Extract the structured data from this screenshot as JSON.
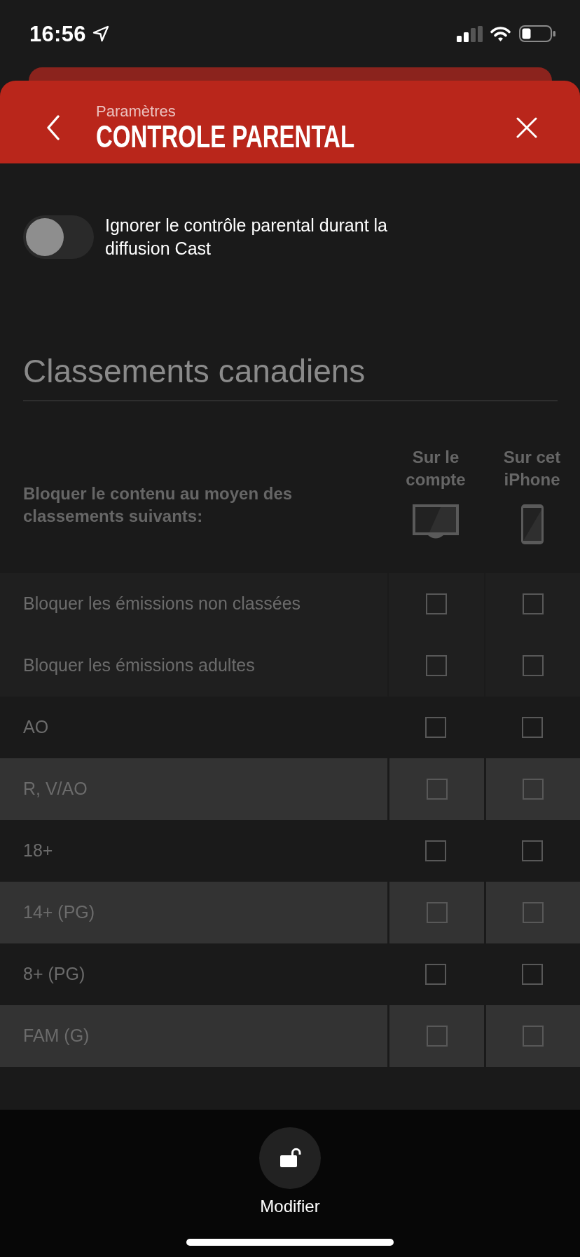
{
  "status_bar": {
    "time": "16:56"
  },
  "header": {
    "subtitle": "Paramètres",
    "title": "CONTROLE PARENTAL"
  },
  "cast_toggle": {
    "label": "Ignorer le contrôle parental durant la diffusion Cast",
    "on": false
  },
  "section": {
    "title": "Classements canadiens"
  },
  "table": {
    "heading": "Bloquer le contenu au moyen des classements suivants:",
    "columns": [
      {
        "label": "Sur le compte",
        "kind": "account"
      },
      {
        "label": "Sur cet iPhone",
        "kind": "device"
      }
    ],
    "rows": [
      {
        "kind": "filter",
        "label": "Bloquer les émissions non classées",
        "cells": [
          {
            "checked": false
          },
          {
            "checked": false
          }
        ]
      },
      {
        "kind": "filter",
        "label": "Bloquer les émissions adultes",
        "cells": [
          {
            "checked": false
          },
          {
            "checked": false
          }
        ]
      },
      {
        "kind": "rating",
        "label": "AO",
        "cells": [
          {
            "checked": false
          },
          {
            "checked": false
          }
        ]
      },
      {
        "kind": "rating",
        "label": "R, V/AO",
        "cells": [
          {
            "checked": false
          },
          {
            "checked": false
          }
        ]
      },
      {
        "kind": "rating",
        "label": "18+",
        "cells": [
          {
            "checked": false
          },
          {
            "checked": false
          }
        ]
      },
      {
        "kind": "rating",
        "label": "14+ (PG)",
        "cells": [
          {
            "checked": false
          },
          {
            "checked": false
          }
        ]
      },
      {
        "kind": "rating",
        "label": "8+ (PG)",
        "cells": [
          {
            "checked": false
          },
          {
            "checked": false
          }
        ]
      },
      {
        "kind": "rating",
        "label": "FAM (G)",
        "cells": [
          {
            "checked": false
          },
          {
            "checked": false
          }
        ]
      }
    ]
  },
  "bottom_bar": {
    "button": "Modifier"
  }
}
